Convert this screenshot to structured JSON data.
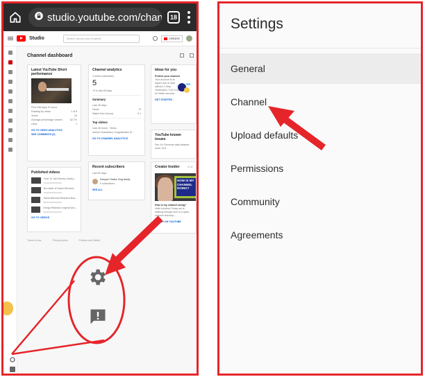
{
  "browser": {
    "url": "studio.youtube.com/channel",
    "tab_count": "18"
  },
  "studio": {
    "brand": "Studio",
    "search_placeholder": "Search across your channel",
    "create_label": "CREATE",
    "dashboard_title": "Channel dashboard"
  },
  "cards": {
    "latest_short": {
      "title": "Latest YouTube Short performance",
      "meta": "First 338 days 11 hours",
      "rows": [
        "Ranking by views",
        "Views",
        "Average percentage viewed",
        "Likes"
      ],
      "values": [
        "1 of 5",
        "24",
        "62.7%",
        "1"
      ],
      "link_analytics": "GO TO VIDEO ANALYTICS",
      "link_comments": "SEE COMMENTS (0)"
    },
    "channel_analytics": {
      "title": "Channel analytics",
      "subs_label": "Current subscribers",
      "subs_value": "5",
      "subs_delta": "+0 in last 28 days",
      "summary_title": "Summary",
      "summary_period": "Last 28 days",
      "summary_rows": [
        "Views",
        "Watch time (hours)"
      ],
      "summary_values": [
        "73",
        "0.1"
      ],
      "top_videos_title": "Top videos",
      "top_videos_period": "Last 48 hours · Views",
      "top_video": "Ashish Chaudhary Congratulates Sr...",
      "link": "GO TO CHANNEL ANALYTICS"
    },
    "ideas": {
      "title": "Ideas for you",
      "headline": "Protect your channel",
      "body": "Your account is at higher risk of hack without 2-Step Verification. Turn it on for better security.",
      "link": "GET STARTED"
    },
    "known_issues": {
      "title": "YouTube known issues",
      "body": "Dec 16: Revenue data delayed since 12/4"
    },
    "published": {
      "title": "Published videos",
      "videos": [
        "How To Join Money Library...",
        "Bro state of Harsh Beniwal...",
        "Harsh Beniwal Reaction Bos...",
        "Dengo Reaction Legend Ans..."
      ],
      "link": "GO TO VIDEOS"
    },
    "recent_subs": {
      "title": "Recent subscribers",
      "period": "Last 90 days",
      "subscriber_name": "Deepan Thakur Vlog family",
      "subscriber_meta": "0 subscribers",
      "link": "SEE ALL"
    },
    "creator_insider": {
      "title": "Creator Insider",
      "pager": "1 / 3",
      "thumb_text": "HOW IS MY CHANNEL DOING?",
      "video_title": "How is my channel doing?",
      "body": "Hello Insiders! Today we're walking through how to a quick channel checkup...",
      "link": "WATCH ON YOUTUBE"
    }
  },
  "footer": {
    "links": [
      "Terms of use",
      "Privacy policy",
      "Policies and Safety"
    ]
  },
  "settings": {
    "title": "Settings",
    "items": [
      "General",
      "Channel",
      "Upload defaults",
      "Permissions",
      "Community",
      "Agreements"
    ],
    "selected": "General"
  },
  "annotations": {
    "border_color": "#e5252a",
    "arrow_color": "#e5252a"
  }
}
